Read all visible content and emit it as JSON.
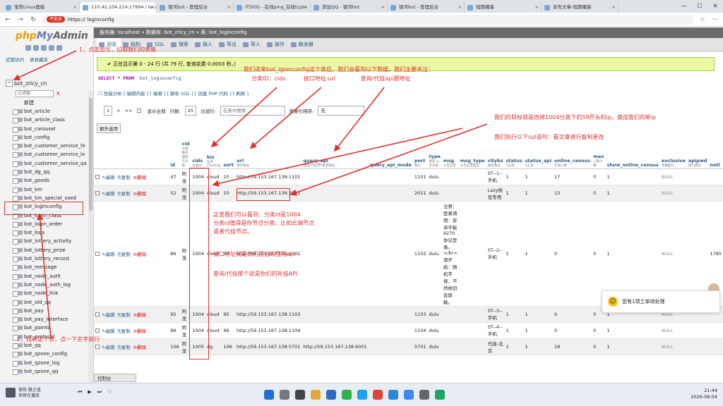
{
  "browser": {
    "tabs": [
      {
        "label": "宝塔Linux面板"
      },
      {
        "label": "110.42.104.214:17994 / locall",
        "active": true
      },
      {
        "label": "银河bot - 管理后台"
      },
      {
        "label": "ITDOG - 在线ping_在线tcpin"
      },
      {
        "label": "添加QQ - 银河bot"
      },
      {
        "label": "银河bot - 管理后台"
      },
      {
        "label": "短期播客"
      },
      {
        "label": "发布文章‹短期播客"
      }
    ],
    "insecure_label": "不安全",
    "url": "https://                                                              loginconfig"
  },
  "sidebar": {
    "logo_php": "php",
    "logo_my": "My",
    "logo_admin": "Admin",
    "recent": "近期访问",
    "favorites": "表收藏夹",
    "db_name": "bot_zrlcy_cn",
    "filter_placeholder": "过滤器",
    "filter_clear": "X",
    "new_label": "新建",
    "tables": [
      "bot_article",
      "bot_article_class",
      "bot_carousel",
      "bot_config",
      "bot_customer_service_fe",
      "bot_customer_service_lo",
      "bot_customer_service_qa",
      "bot_dg_qq",
      "bot_goods",
      "bot_km",
      "bot_km_special_used",
      "bot_loginconfig",
      "bot_login_class",
      "bot_login_order",
      "bot_logs",
      "bot_lottery_activity",
      "bot_lottery_prize",
      "bot_lottery_record",
      "bot_message",
      "bot_node_auth",
      "bot_node_auth_log",
      "bot_node_link",
      "bot_old_qq",
      "bot_pay",
      "bot_pay_interface",
      "bot_points",
      "bot_protocol",
      "bot_qq",
      "bot_qzone_config",
      "bot_qzone_log",
      "bot_qzone_qq"
    ]
  },
  "main": {
    "breadcrumb": "服务器: localhost » 数据库: bot_zrlcy_cn » 表: bot_loginconfig",
    "menu": [
      "浏览",
      "结构",
      "SQL",
      "搜索",
      "插入",
      "导出",
      "导入",
      "操作",
      "触发器"
    ],
    "success": "✔ 正在显示第 0 - 24 行 (共 79 行, 查询花费 0.0003 秒。)",
    "sql_keyword": "SELECT * FROM",
    "sql_table": "`bot_loginconfig`",
    "sql_links": "☐ 性能分析 [ 编辑内嵌 ] [ 编辑 ] [ 解析 SQL ] [ 创建 PHP 代码 ] [ 刷新 ]",
    "pager": {
      "page": "1",
      "next": ">",
      "last": ">>",
      "show_all": "显示全部",
      "rows_label": "行数:",
      "rows": "25",
      "filter_label": "过滤行:",
      "filter_placeholder": "在表中搜索",
      "sort_label": "按索引排序:",
      "sort_value": "无"
    },
    "extra_options": "额外选项",
    "columns": [
      {
        "name": "id",
        "sub": ""
      },
      {
        "name": "cid",
        "sub": "分类 服务器所在分类"
      },
      {
        "name": "cids",
        "sub": "分类id"
      },
      {
        "name": "biz",
        "sub": "业务 cloud/dg"
      },
      {
        "name": "sort",
        "sub": ""
      },
      {
        "name": "url",
        "sub": "请求地址"
      },
      {
        "name": "query_api",
        "sub": "查询/代挂API请求地址"
      },
      {
        "name": "query_api_mode",
        "sub": ""
      },
      {
        "name": "port",
        "sub": "端口"
      },
      {
        "name": "type",
        "sub": "类型 公告分类"
      },
      {
        "name": "msg",
        "sub": "公告信息"
      },
      {
        "name": "msg_type",
        "sub": "公告信息类型"
      },
      {
        "name": "citybz",
        "sub": "地区备注"
      },
      {
        "name": "status",
        "sub": "1正常"
      },
      {
        "name": "status_api",
        "sub": "1正常"
      },
      {
        "name": "online_census",
        "sub": "在线人数"
      },
      {
        "name": "max",
        "sub": "上限人数"
      },
      {
        "name": "show_online_census",
        "sub": ""
      },
      {
        "name": "exclusive",
        "sub": "专属接口"
      },
      {
        "name": "apipwd",
        "sub": "接口密码"
      },
      {
        "name": "noti",
        "sub": ""
      }
    ],
    "actions": {
      "edit": "编辑",
      "copy": "复制",
      "delete": "删除"
    },
    "rows": [
      {
        "id": "47",
        "cid": "阿龙",
        "cids": "1004",
        "biz": "cloud",
        "sort": "10",
        "url": "http://59.153.167.138:1101",
        "query_api": "",
        "port": "1101",
        "type": "dulu",
        "msg": "",
        "msg_type": "",
        "citybz": "ST--1--手机",
        "status": "1",
        "status_api": "1",
        "online": "17",
        "max": "0",
        "show": "1",
        "exclusive": "NULL",
        "extra": ""
      },
      {
        "id": "52",
        "cid": "阿龙",
        "cids": "1004",
        "biz": "cloud",
        "sort": "10",
        "url": "http://59.153.167.138:2011",
        "query_api": "",
        "port": "2011",
        "type": "dulu",
        "msg": "",
        "msg_type": "",
        "citybz": "Lazy抢包专用",
        "status": "1",
        "status_api": "1",
        "online": "13",
        "max": "0",
        "show": "1",
        "exclusive": "NULL",
        "extra": ""
      },
      {
        "id": "86",
        "cid": "阿龙",
        "cids": "1004",
        "biz": "cloud",
        "sort": "10",
        "url": "http://59.153.167.138:1102",
        "query_api": "",
        "port": "1102",
        "type": "dulu",
        "msg": "注意：登录请用：安卓平板9270协议登录。</br>请开启：随机字母，不然依旧会屏蔽。",
        "msg_type": "",
        "citybz": "ST--2--手机",
        "status": "1",
        "status_api": "1",
        "online": "0",
        "max": "0",
        "show": "1",
        "exclusive": "NULL",
        "extra": "1785"
      },
      {
        "id": "95",
        "cid": "阿龙",
        "cids": "1004",
        "biz": "cloud",
        "sort": "95",
        "url": "http://59.153.167.138:1103",
        "query_api": "",
        "port": "1103",
        "type": "dulu",
        "msg": "",
        "msg_type": "",
        "citybz": "ST--3--手机",
        "status": "1",
        "status_api": "1",
        "online": "6",
        "max": "0",
        "show": "1",
        "exclusive": "NULL",
        "extra": ""
      },
      {
        "id": "96",
        "cid": "阿龙",
        "cids": "1004",
        "biz": "cloud",
        "sort": "96",
        "url": "http://59.153.167.138:1104",
        "query_api": "",
        "port": "1104",
        "type": "dulu",
        "msg": "",
        "msg_type": "",
        "citybz": "ST--4--手机",
        "status": "1",
        "status_api": "1",
        "online": "0",
        "max": "0",
        "show": "1",
        "exclusive": "NULL",
        "extra": ""
      },
      {
        "id": "106",
        "cid": "阿龙",
        "cids": "1005",
        "biz": "dg",
        "sort": "106",
        "url": "http://59.153.167.138:5701",
        "query_api": "http://59.153.167.138:6001",
        "port": "5701",
        "type": "dulu",
        "msg": "",
        "msg_type": "",
        "citybz": "代挂-北京",
        "status": "1",
        "status_api": "1",
        "online": "18",
        "max": "0",
        "show": "1",
        "exclusive": "NULL",
        "extra": ""
      }
    ],
    "console": "控制台"
  },
  "annotations": {
    "a1": "1，点击加号，拉取我们的表格",
    "a2": "2，找到这个表，点一下名字就行",
    "a3": "我们进来bot_lgoinconfig这个表后，我们会看到以下数据，我们主要关注：",
    "a3b": "分类ID：cids          接口地址:url              查询/代挂api跟地址",
    "a4": "我们的目标就是改掉1004分类下的59开头的ip，换成我们的新ip",
    "a5": "我们执行以下sql语句：看文章进行复制更改",
    "a6": "这里我们可以看到，分类id是1004",
    "a6b": "分类id值得是你节点分类，比如云端节点",
    "a6c": "或者代挂节点。",
    "a7": "接口地址就是你们后台的登陆api",
    "a8": "查询/代挂那个就是你们的补挂API"
  },
  "chat": {
    "text": "您有1项工单待处理"
  },
  "taskbar": {
    "weather_top": "保热·路之道",
    "weather_bottom": "项目在播放",
    "time": "21:44",
    "date": "2026-08-04"
  }
}
